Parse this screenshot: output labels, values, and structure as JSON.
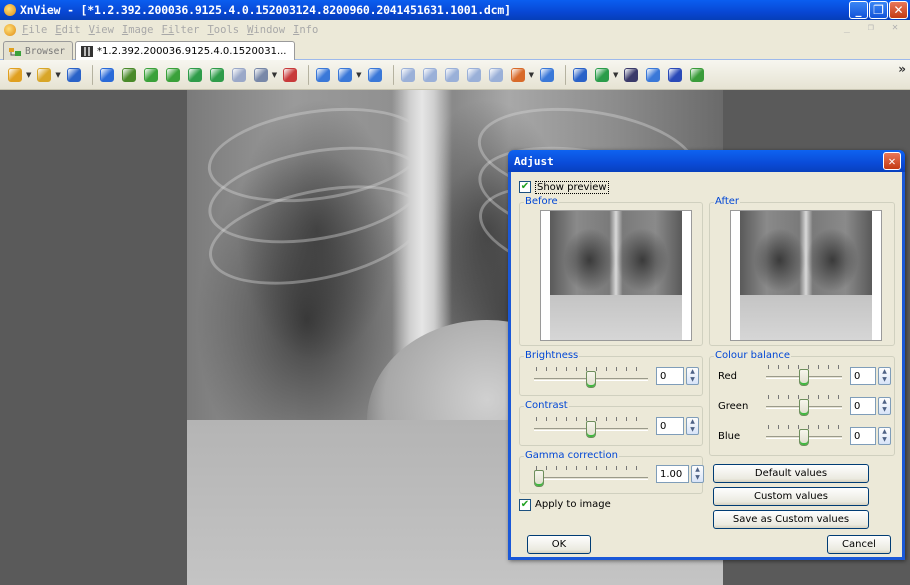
{
  "window": {
    "title": "XnView - [*1.2.392.200036.9125.4.0.152003124.8200960.2041451631.1001.dcm]",
    "min_glyph": "_",
    "max_glyph": "❐",
    "close_glyph": "✕"
  },
  "menu": {
    "items": [
      {
        "key": "F",
        "rest": "ile"
      },
      {
        "key": "E",
        "rest": "dit"
      },
      {
        "key": "V",
        "rest": "iew"
      },
      {
        "key": "I",
        "rest": "mage"
      },
      {
        "key": "Fi",
        "rest": "lter"
      },
      {
        "key": "T",
        "rest": "ools"
      },
      {
        "key": "W",
        "rest": "indow"
      },
      {
        "key": "I",
        "rest": "nfo"
      }
    ],
    "mdi_controls": "_ ❐ ✕"
  },
  "tabs": [
    {
      "label": "Browser"
    },
    {
      "label": "*1.2.392.200036.9125.4.0.1520031..."
    }
  ],
  "toolbar": {
    "overflow": "»",
    "buttons": [
      {
        "icon": "tree-icon",
        "color": "#e0a020",
        "dd": true
      },
      {
        "icon": "open-folder-icon",
        "color": "#d8a628",
        "dd": true
      },
      {
        "icon": "save-icon",
        "color": "#2a62c8"
      },
      {
        "sep": true
      },
      {
        "icon": "undo-icon",
        "color": "#2a6ad8"
      },
      {
        "icon": "crop-icon",
        "color": "#4a8a2a"
      },
      {
        "icon": "rotate-left-icon",
        "color": "#3aa13a"
      },
      {
        "icon": "rotate-right-icon",
        "color": "#3aa13a"
      },
      {
        "icon": "flip-icon",
        "color": "#2f9c4a"
      },
      {
        "icon": "resize-icon",
        "color": "#2f9c4a"
      },
      {
        "icon": "image-icon",
        "color": "#9aa8c8"
      },
      {
        "icon": "adjust-icon",
        "color": "#7888a8",
        "dd": true
      },
      {
        "icon": "redeye-icon",
        "color": "#c83a3a"
      },
      {
        "sep": true
      },
      {
        "icon": "zoom-in-icon",
        "color": "#3a78d8"
      },
      {
        "icon": "zoom-icon",
        "color": "#3a78d8",
        "dd": true
      },
      {
        "icon": "zoom-out-icon",
        "color": "#3a78d8"
      },
      {
        "sep": true
      },
      {
        "icon": "prev-icon",
        "color": "#9ab0d8"
      },
      {
        "icon": "next-icon",
        "color": "#9ab0d8"
      },
      {
        "icon": "first-icon",
        "color": "#9ab0d8"
      },
      {
        "icon": "last-icon",
        "color": "#9ab0d8"
      },
      {
        "icon": "page-icon",
        "color": "#9ab0d8"
      },
      {
        "icon": "slideshow-icon",
        "color": "#d86a2a",
        "dd": true
      },
      {
        "icon": "capture-icon",
        "color": "#3a78d8"
      },
      {
        "sep": true
      },
      {
        "icon": "fullscreen-icon",
        "color": "#2a62c8"
      },
      {
        "icon": "export-icon",
        "color": "#2a9c4a",
        "dd": true
      },
      {
        "icon": "binoculars-icon",
        "color": "#3a3a6a"
      },
      {
        "icon": "print-icon",
        "color": "#3a78d8"
      },
      {
        "icon": "scanner-icon",
        "color": "#2a4ab8"
      },
      {
        "icon": "convert-icon",
        "color": "#3a9c3a"
      }
    ]
  },
  "dialog": {
    "title": "Adjust",
    "close_glyph": "✕",
    "show_preview": {
      "label": "Show preview",
      "checked": true
    },
    "before_label": "Before",
    "after_label": "After",
    "brightness": {
      "label": "Brightness",
      "value": "0",
      "level": 0.5
    },
    "contrast": {
      "label": "Contrast",
      "value": "0",
      "level": 0.5
    },
    "gamma": {
      "label": "Gamma correction",
      "value": "1.00",
      "level": 0.0
    },
    "colour_balance": {
      "label": "Colour balance",
      "red": {
        "label": "Red",
        "value": "0",
        "level": 0.5
      },
      "green": {
        "label": "Green",
        "value": "0",
        "level": 0.5
      },
      "blue": {
        "label": "Blue",
        "value": "0",
        "level": 0.5
      }
    },
    "default_values": "Default values",
    "custom_values": "Custom values",
    "save_custom": "Save as Custom values",
    "apply_to_image": {
      "label": "Apply to image",
      "checked": true
    },
    "ok": "OK",
    "cancel": "Cancel",
    "check_glyph": "✔",
    "spin_up": "▲",
    "spin_down": "▼"
  }
}
